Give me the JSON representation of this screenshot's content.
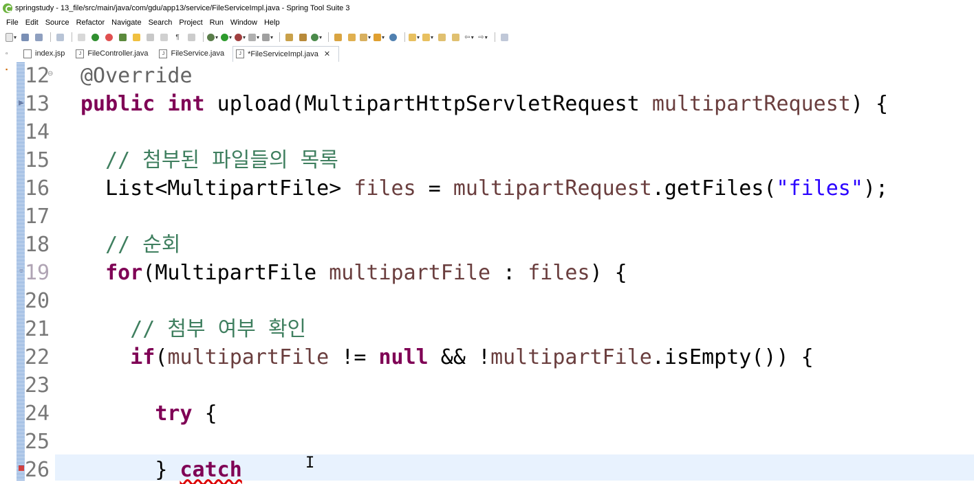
{
  "window": {
    "title": "springstudy - 13_file/src/main/java/com/gdu/app13/service/FileServiceImpl.java - Spring Tool Suite 3"
  },
  "menu": [
    "File",
    "Edit",
    "Source",
    "Refactor",
    "Navigate",
    "Search",
    "Project",
    "Run",
    "Window",
    "Help"
  ],
  "tabs": [
    {
      "label": "index.jsp",
      "icon": "jsp-file-icon",
      "active": false
    },
    {
      "label": "FileController.java",
      "icon": "java-file-icon",
      "active": false
    },
    {
      "label": "FileService.java",
      "icon": "java-file-icon",
      "active": false
    },
    {
      "label": "*FileServiceImpl.java",
      "icon": "java-file-icon",
      "active": true
    }
  ],
  "editor": {
    "current_line": "26",
    "lines": [
      {
        "n": "12",
        "text": "@Override"
      },
      {
        "n": "13",
        "text": "public int upload(MultipartHttpServletRequest multipartRequest) {"
      },
      {
        "n": "14",
        "text": ""
      },
      {
        "n": "15",
        "text": "  // 첨부된 파일들의 목록"
      },
      {
        "n": "16",
        "text": "  List<MultipartFile> files = multipartRequest.getFiles(\"files\");"
      },
      {
        "n": "17",
        "text": ""
      },
      {
        "n": "18",
        "text": "  // 순회"
      },
      {
        "n": "19",
        "text": "  for(MultipartFile multipartFile : files) {"
      },
      {
        "n": "20",
        "text": ""
      },
      {
        "n": "21",
        "text": "    // 첨부 여부 확인"
      },
      {
        "n": "22",
        "text": "    if(multipartFile != null && !multipartFile.isEmpty()) {"
      },
      {
        "n": "23",
        "text": ""
      },
      {
        "n": "24",
        "text": "      try {"
      },
      {
        "n": "25",
        "text": ""
      },
      {
        "n": "26",
        "text": "      } catch"
      }
    ]
  },
  "colors": {
    "keyword": "#7f0055",
    "comment": "#3f7f5f",
    "string": "#2a00ff",
    "variable": "#6a3e3e",
    "annotation": "#646464"
  }
}
